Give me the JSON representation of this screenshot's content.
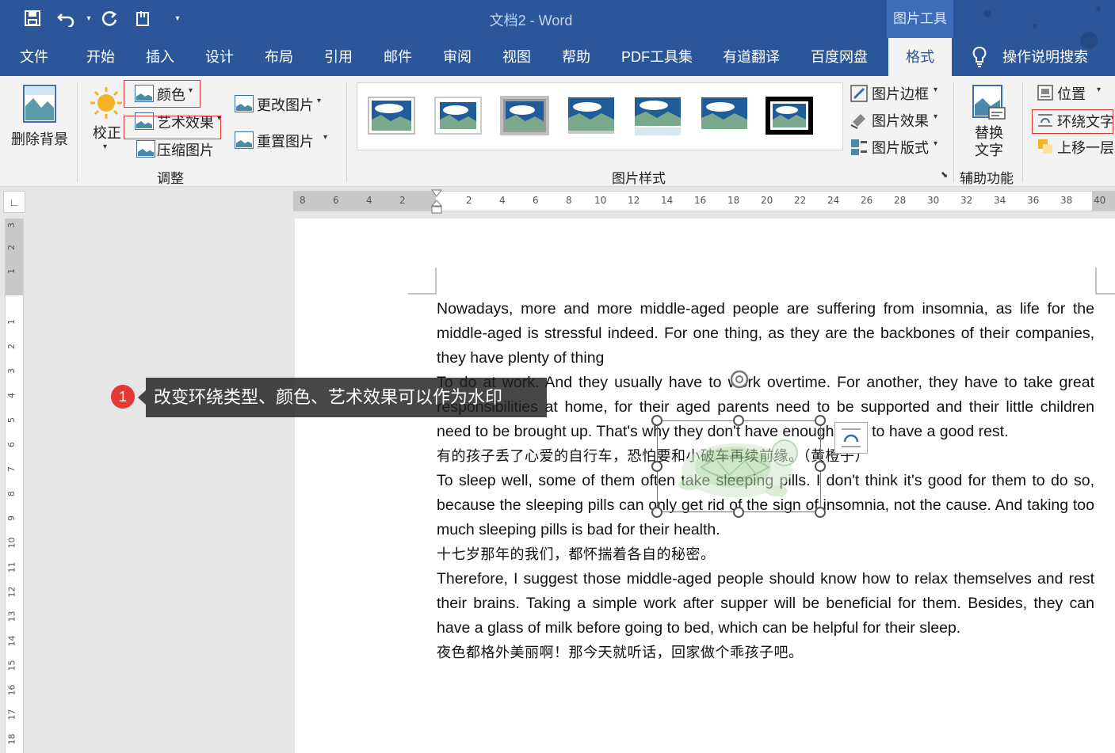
{
  "window": {
    "doc_title": "文档2  -  Word",
    "contextual_title": "图片工具"
  },
  "quick_access": {
    "save_icon": "save-icon",
    "undo_icon": "undo-icon",
    "redo_icon": "redo-icon",
    "touch_icon": "touch-mode-icon",
    "customize_icon": "customize-icon"
  },
  "tabs": [
    "文件",
    "开始",
    "插入",
    "设计",
    "布局",
    "引用",
    "邮件",
    "审阅",
    "视图",
    "帮助",
    "PDF工具集",
    "有道翻译",
    "百度网盘",
    "格式"
  ],
  "active_tab": "格式",
  "tell_me": "操作说明搜索",
  "ribbon": {
    "remove_background": "删除背景",
    "corrections": "校正",
    "color": "颜色",
    "artistic_effects": "艺术效果",
    "compress": "压缩图片",
    "change_picture": "更改图片",
    "reset_picture": "重置图片",
    "adjust_group": "调整",
    "picture_border": "图片边框",
    "picture_effects": "图片效果",
    "picture_layout": "图片版式",
    "styles_group": "图片样式",
    "alt_text": "替换\n文字",
    "alt_text_line1": "替换",
    "alt_text_line2": "文字",
    "accessibility_group": "辅助功能",
    "position": "位置",
    "wrap_text": "环绕文字",
    "bring_forward": "上移一层"
  },
  "ruler": {
    "left_ticks": [
      "8",
      "6",
      "4",
      "2"
    ],
    "right_ticks": [
      "2",
      "4",
      "6",
      "8",
      "10",
      "12",
      "14",
      "16",
      "18",
      "20",
      "22",
      "24",
      "26",
      "28",
      "30",
      "32",
      "34",
      "36",
      "38",
      "40"
    ],
    "vertical_top": [
      "3",
      "2",
      "1"
    ],
    "vertical": [
      "1",
      "2",
      "3",
      "4",
      "5",
      "6",
      "7",
      "8",
      "9",
      "10",
      "11",
      "12",
      "13",
      "14",
      "15",
      "16",
      "17",
      "18"
    ]
  },
  "document": {
    "paragraphs": [
      {
        "text": "Nowadays, more and more middle-aged people are suffering from insomnia, as life for the middle-aged is stressful indeed. For one thing, as they are the backbones of their companies, they have plenty of thing",
        "cn": false
      },
      {
        "text": "To do at work. And they usually have to work overtime. For another, they have to take great responsibilities at home, for their aged parents need to be supported and their little children need to be brought up. That's why they don't have enough time to have a good rest.",
        "cn": false
      },
      {
        "text": "有的孩子丢了心爱的自行车，恐怕要和小破车再续前缘。（黄橙子）",
        "cn": true
      },
      {
        "text": "To sleep well, some of them often take sleeping pills. I don't think it's good for them to do so, because the sleeping pills can only get rid of the sign of insomnia, not the cause. And taking too much sleeping pills is bad for their health.",
        "cn": false
      },
      {
        "text": "十七岁那年的我们，都怀揣着各自的秘密。",
        "cn": true
      },
      {
        "text": "Therefore, I suggest those middle-aged people should know how to relax themselves and rest their brains. Taking a simple work after supper will be beneficial for them. Besides, they can have a glass of milk before going to bed, which can be helpful for their sleep.",
        "cn": false
      },
      {
        "text": "夜色都格外美丽啊！那今天就听话，回家做个乖孩子吧。",
        "cn": true
      }
    ]
  },
  "callout": {
    "number": "1",
    "text": "改变环绕类型、颜色、艺术效果可以作为水印"
  },
  "colors": {
    "accent": "#2b579a",
    "highlight_box": "#e53935",
    "badge": "#e53935"
  }
}
